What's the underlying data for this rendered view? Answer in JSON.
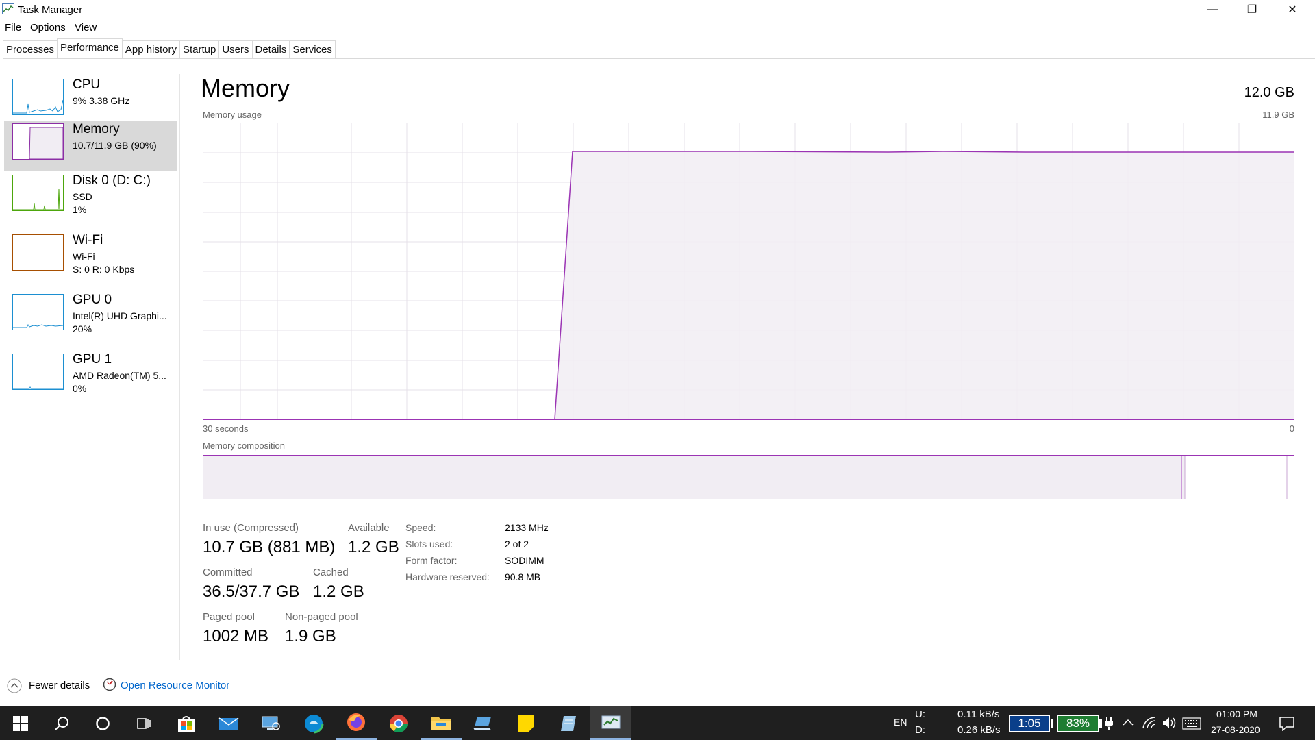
{
  "window": {
    "title": "Task Manager",
    "controls": {
      "minimize": "—",
      "restore": "❐",
      "close": "✕"
    }
  },
  "menu": [
    "File",
    "Options",
    "View"
  ],
  "tabs": [
    "Processes",
    "Performance",
    "App history",
    "Startup",
    "Users",
    "Details",
    "Services"
  ],
  "active_tab": "Performance",
  "sidebar": [
    {
      "name": "CPU",
      "line1": "9%  3.38 GHz",
      "line2": "",
      "color": "#1c8fd1",
      "selected": false
    },
    {
      "name": "Memory",
      "line1": "10.7/11.9 GB (90%)",
      "line2": "",
      "color": "#8c2ea5",
      "selected": true
    },
    {
      "name": "Disk 0 (D: C:)",
      "line1": "SSD",
      "line2": "1%",
      "color": "#4da60c",
      "selected": false
    },
    {
      "name": "Wi-Fi",
      "line1": "Wi-Fi",
      "line2": "S: 0  R: 0 Kbps",
      "color": "#a74f01",
      "selected": false
    },
    {
      "name": "GPU 0",
      "line1": "Intel(R) UHD Graphi...",
      "line2": "20%",
      "color": "#1c8fd1",
      "selected": false
    },
    {
      "name": "GPU 1",
      "line1": "AMD Radeon(TM) 5...",
      "line2": "0%",
      "color": "#1c8fd1",
      "selected": false
    }
  ],
  "main": {
    "title": "Memory",
    "total": "12.0 GB",
    "usage_label": "Memory usage",
    "usage_max": "11.9 GB",
    "time_label": "30 seconds",
    "time_zero": "0",
    "composition_label": "Memory composition",
    "accent_color": "#9b34b4",
    "stats": {
      "in_use_label": "In use (Compressed)",
      "in_use_value": "10.7 GB (881 MB)",
      "available_label": "Available",
      "available_value": "1.2 GB",
      "committed_label": "Committed",
      "committed_value": "36.5/37.7 GB",
      "cached_label": "Cached",
      "cached_value": "1.2 GB",
      "paged_label": "Paged pool",
      "paged_value": "1002 MB",
      "nonpaged_label": "Non-paged pool",
      "nonpaged_value": "1.9 GB"
    },
    "props": {
      "speed_label": "Speed:",
      "speed_value": "2133 MHz",
      "slots_label": "Slots used:",
      "slots_value": "2 of 2",
      "form_label": "Form factor:",
      "form_value": "SODIMM",
      "hw_label": "Hardware reserved:",
      "hw_value": "90.8 MB"
    }
  },
  "footer": {
    "fewer_details": "Fewer details",
    "open_resource_monitor": "Open Resource Monitor"
  },
  "taskbar": {
    "lang": "EN",
    "upload_label": "U:",
    "download_label": "D:",
    "upload_value": "0.11 kB/s",
    "download_value": "0.26 kB/s",
    "timer": "1:05",
    "battery": "83%",
    "time": "01:00 PM",
    "date": "27-08-2020"
  }
}
